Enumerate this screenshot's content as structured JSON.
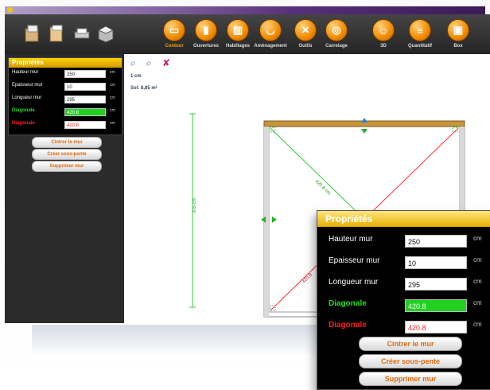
{
  "toolbar": {
    "tools": [
      {
        "label": "Contour",
        "icon": "contour-icon",
        "active": true
      },
      {
        "label": "Ouvertures",
        "icon": "door-icon",
        "active": false
      },
      {
        "label": "Habillages",
        "icon": "paint-icon",
        "active": false
      },
      {
        "label": "Aménagement",
        "icon": "bathtub-icon",
        "active": false
      },
      {
        "label": "Outils",
        "icon": "hammer-icon",
        "active": false
      },
      {
        "label": "Carrelage",
        "icon": "tiles-icon",
        "active": false
      },
      {
        "label": "3D",
        "icon": "3d-icon",
        "active": false
      },
      {
        "label": "Quantitatif",
        "icon": "list-icon",
        "active": false
      },
      {
        "label": "Box",
        "icon": "box-icon",
        "active": false
      }
    ]
  },
  "sidebar": {
    "panel_title": "Propriétés",
    "rows": [
      {
        "label": "Hauteur mur",
        "value": "250",
        "unit": "cm",
        "color": "#ffffff"
      },
      {
        "label": "Epaisseur mur",
        "value": "10",
        "unit": "cm",
        "color": "#ffffff"
      },
      {
        "label": "Longueur mur",
        "value": "295",
        "unit": "cm",
        "color": "#ffffff"
      },
      {
        "label": "Diagonale",
        "value": "420.8",
        "unit": "cm",
        "color": "#22e022"
      },
      {
        "label": "Diagonale",
        "value": "420.8",
        "unit": "cm",
        "color": "#ff2020"
      }
    ],
    "buttons": [
      "Cintrer le mur",
      "Créer sous-pente",
      "Supprimer mur"
    ]
  },
  "canvas": {
    "scale": "1 cm",
    "sol": "Sol: 8,85 m²",
    "vertical_dim": "305 cm",
    "diag_green": "420.8 cm",
    "diag_red": "420.8"
  },
  "float_panel": {
    "title": "Propriétés",
    "rows": [
      {
        "label": "Hauteur mur",
        "value": "250",
        "unit": "cm",
        "color": "#ffffff"
      },
      {
        "label": "Epaisseur mur",
        "value": "10",
        "unit": "cm",
        "color": "#ffffff"
      },
      {
        "label": "Longueur mur",
        "value": "295",
        "unit": "cm",
        "color": "#ffffff"
      },
      {
        "label": "Diagonale",
        "value": "420.8",
        "unit": "cm",
        "color": "#22e022"
      },
      {
        "label": "Diagonale",
        "value": "420.8",
        "unit": "cm",
        "color": "#ff2020"
      }
    ],
    "buttons": [
      "Cintrer le mur",
      "Créer sous-pente",
      "Supprimer mur"
    ]
  }
}
